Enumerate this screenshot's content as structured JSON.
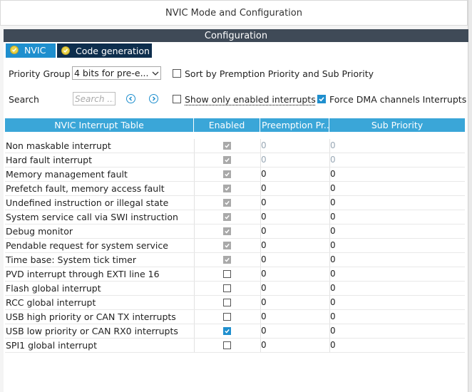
{
  "window": {
    "title": "NVIC Mode and Configuration"
  },
  "panel": {
    "header": "Configuration"
  },
  "tabs": [
    {
      "label": "NVIC",
      "active": true
    },
    {
      "label": "Code generation",
      "active": false
    }
  ],
  "controls": {
    "priority_group_label": "Priority Group",
    "priority_group_value": "4 bits for pre-e...",
    "sort_label": "Sort by Premption Priority and Sub Priority",
    "sort_checked": false,
    "search_label": "Search",
    "search_placeholder": "Search ...",
    "show_enabled_label": "Show only enabled interrupts",
    "show_enabled_checked": false,
    "force_dma_label": "Force DMA channels Interrupts",
    "force_dma_checked": true
  },
  "table": {
    "headers": [
      "NVIC Interrupt Table",
      "Enabled",
      "Preemption Pr...",
      "Sub Priority"
    ],
    "rows": [
      {
        "name": "Non maskable interrupt",
        "enabled": "disabled-checked",
        "preemption": "0",
        "sub": "0",
        "dim": true
      },
      {
        "name": "Hard fault interrupt",
        "enabled": "disabled-checked",
        "preemption": "0",
        "sub": "0",
        "dim": true
      },
      {
        "name": "Memory management fault",
        "enabled": "disabled-checked",
        "preemption": "0",
        "sub": "0",
        "dim": false
      },
      {
        "name": "Prefetch fault, memory access fault",
        "enabled": "disabled-checked",
        "preemption": "0",
        "sub": "0",
        "dim": false
      },
      {
        "name": "Undefined instruction or illegal state",
        "enabled": "disabled-checked",
        "preemption": "0",
        "sub": "0",
        "dim": false
      },
      {
        "name": "System service call via SWI instruction",
        "enabled": "disabled-checked",
        "preemption": "0",
        "sub": "0",
        "dim": false
      },
      {
        "name": "Debug monitor",
        "enabled": "disabled-checked",
        "preemption": "0",
        "sub": "0",
        "dim": false
      },
      {
        "name": "Pendable request for system service",
        "enabled": "disabled-checked",
        "preemption": "0",
        "sub": "0",
        "dim": false
      },
      {
        "name": "Time base: System tick timer",
        "enabled": "disabled-checked",
        "preemption": "0",
        "sub": "0",
        "dim": false
      },
      {
        "name": "PVD interrupt through EXTI line 16",
        "enabled": "unchecked",
        "preemption": "0",
        "sub": "0",
        "dim": false
      },
      {
        "name": "Flash global interrupt",
        "enabled": "unchecked",
        "preemption": "0",
        "sub": "0",
        "dim": false
      },
      {
        "name": "RCC global interrupt",
        "enabled": "unchecked",
        "preemption": "0",
        "sub": "0",
        "dim": false
      },
      {
        "name": "USB high priority or CAN TX interrupts",
        "enabled": "unchecked",
        "preemption": "0",
        "sub": "0",
        "dim": false
      },
      {
        "name": "USB low priority or CAN RX0 interrupts",
        "enabled": "checked",
        "preemption": "0",
        "sub": "0",
        "dim": false
      },
      {
        "name": "SPI1 global interrupt",
        "enabled": "unchecked",
        "preemption": "0",
        "sub": "0",
        "dim": false
      }
    ]
  },
  "colors": {
    "accent": "#1f8fce",
    "header_blue": "#3aa6d8",
    "panel_dark": "#3f4a57",
    "tab_dark": "#0e2e4d",
    "disabled_check": "#a9a9a9"
  },
  "icons": {
    "tab_status": "check-circle-icon",
    "prev": "arrow-left-circle-icon",
    "next": "arrow-right-circle-icon",
    "dropdown": "chevron-down-icon",
    "check": "check-icon"
  }
}
